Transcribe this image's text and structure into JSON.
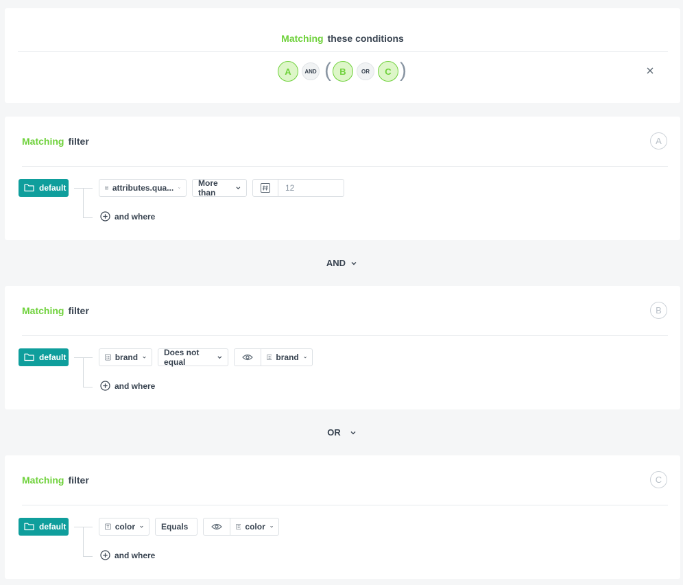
{
  "summary": {
    "heading_green": "Matching",
    "heading_rest": "these conditions",
    "formula": {
      "a": "A",
      "op1": "AND",
      "open_paren": "(",
      "b": "B",
      "op2": "OR",
      "c": "C",
      "close_paren": ")"
    },
    "close_icon": "close-icon"
  },
  "filters": [
    {
      "heading_green": "Matching",
      "heading_rest": "filter",
      "letter": "A",
      "source": "default",
      "attribute": {
        "label": "attributes.qua...",
        "icon": "hash-icon"
      },
      "operator": "More than",
      "value_type_icon": "hash-icon",
      "value": "12",
      "and_where": "and where"
    },
    {
      "heading_green": "Matching",
      "heading_rest": "filter",
      "letter": "B",
      "source": "default",
      "attribute": {
        "label": "brand",
        "icon": "list-icon"
      },
      "operator": "Does not equal",
      "value_icon": "eye-icon",
      "value_attribute": {
        "label": "brand",
        "icon": "list-icon"
      },
      "and_where": "and where"
    },
    {
      "heading_green": "Matching",
      "heading_rest": "filter",
      "letter": "C",
      "source": "default",
      "attribute": {
        "label": "color",
        "icon": "text-icon"
      },
      "operator": "Equals",
      "value_icon": "eye-icon",
      "value_attribute": {
        "label": "color",
        "icon": "list-icon"
      },
      "and_where": "and where"
    }
  ],
  "connectors": [
    "AND",
    "OR"
  ],
  "colors": {
    "accent_green": "#6ed13a",
    "teal": "#0f9e9c",
    "text": "#384350",
    "background": "#f5f6f7"
  }
}
